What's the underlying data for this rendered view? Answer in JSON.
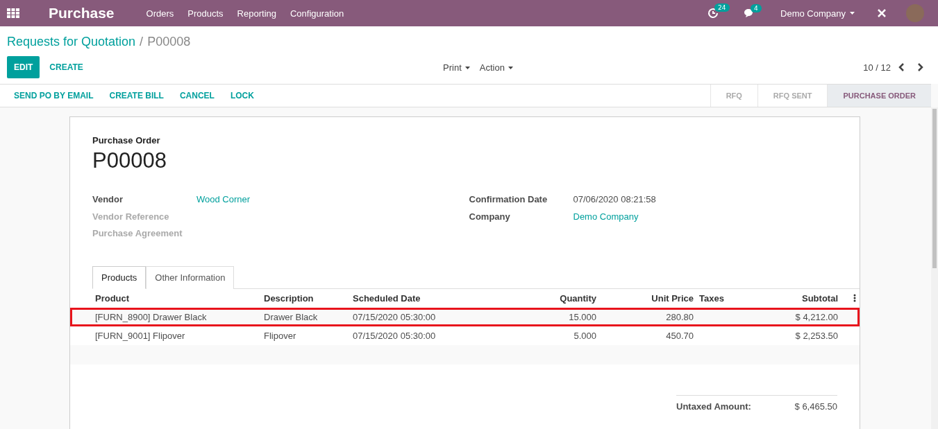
{
  "navbar": {
    "app_title": "Purchase",
    "menu": [
      "Orders",
      "Products",
      "Reporting",
      "Configuration"
    ],
    "activity_count": "24",
    "message_count": "4",
    "company": "Demo Company"
  },
  "breadcrumb": {
    "parent": "Requests for Quotation",
    "separator": "/",
    "current": "P00008"
  },
  "control_panel": {
    "buttons": [
      {
        "label": "EDIT",
        "kind": "primary"
      },
      {
        "label": "CREATE",
        "kind": "link"
      }
    ],
    "menus": [
      "Print",
      "Action"
    ],
    "pager": "10 / 12"
  },
  "status_bar": {
    "buttons": [
      "SEND PO BY EMAIL",
      "CREATE BILL",
      "CANCEL",
      "LOCK"
    ],
    "stages": [
      {
        "label": "RFQ",
        "selected": false
      },
      {
        "label": "RFQ SENT",
        "selected": false
      },
      {
        "label": "PURCHASE ORDER",
        "selected": true
      }
    ]
  },
  "form": {
    "subtitle": "Purchase Order",
    "name": "P00008",
    "left_fields": [
      {
        "label": "Vendor",
        "value": "Wood Corner",
        "empty": false
      },
      {
        "label": "Vendor Reference",
        "empty": true
      },
      {
        "label": "Purchase Agreement",
        "empty": true
      }
    ],
    "right_fields": [
      {
        "label": "Confirmation Date",
        "value": "07/06/2020 08:21:58",
        "kind": "text"
      },
      {
        "label": "Company",
        "value": "Demo Company",
        "kind": "link"
      }
    ],
    "tabs": [
      {
        "label": "Products",
        "selected": true
      },
      {
        "label": "Other Information",
        "selected": false
      }
    ],
    "table": {
      "columns": [
        "Product",
        "Description",
        "Scheduled Date",
        "Quantity",
        "Unit Price",
        "Taxes",
        "Subtotal"
      ],
      "rows": [
        {
          "cells": [
            "[FURN_8900] Drawer Black",
            "Drawer Black",
            "07/15/2020 05:30:00",
            "15.000",
            "280.80",
            "",
            "$ 4,212.00"
          ],
          "highlighted": true
        },
        {
          "cells": [
            "[FURN_9001] Flipover",
            "Flipover",
            "07/15/2020 05:30:00",
            "5.000",
            "450.70",
            "",
            "$ 2,253.50"
          ],
          "highlighted": false
        }
      ]
    },
    "totals": [
      {
        "label": "Untaxed Amount:",
        "value": "$ 6,465.50"
      }
    ]
  }
}
